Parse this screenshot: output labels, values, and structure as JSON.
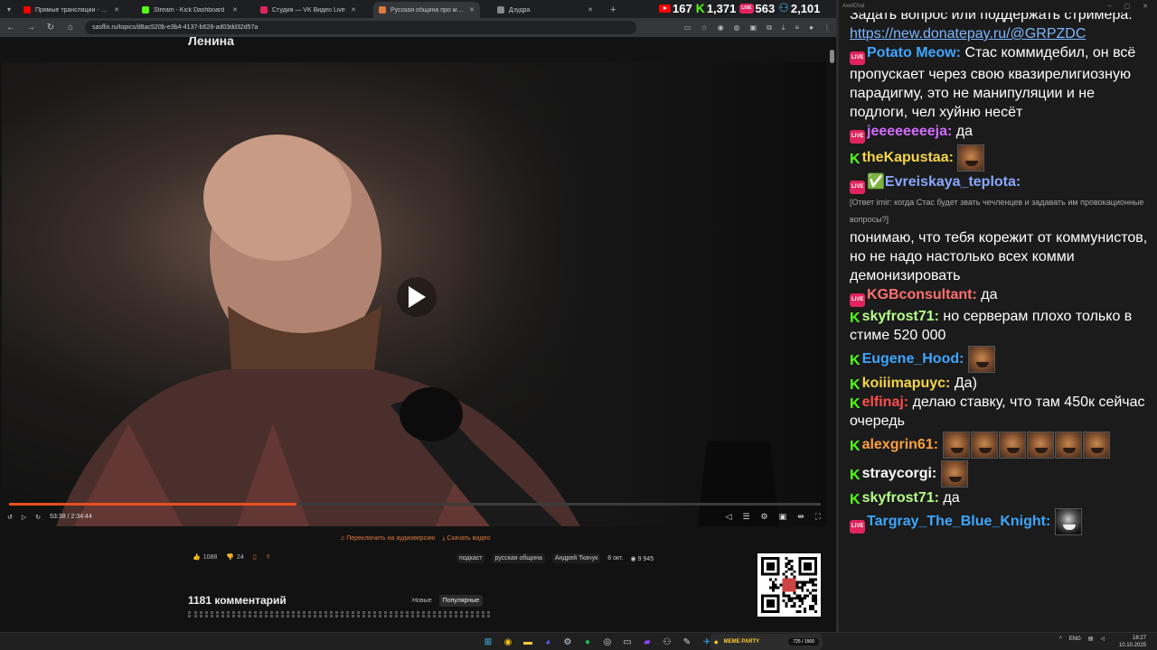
{
  "browser": {
    "tabs": [
      {
        "title": "Прямые трансляции - YouTube",
        "color": "#ff0000"
      },
      {
        "title": "Stream - Kick Dashboard",
        "color": "#53fc18"
      },
      {
        "title": "Студия — VK Видео Live",
        "color": "#e0245e"
      },
      {
        "title": "Русская община про мигрантов...",
        "color": "#e07a3c"
      },
      {
        "title": "Дзудра",
        "color": "#888888"
      }
    ],
    "url": "sasflix.ru/topics/d8ac520b-e3b4-4137-b628-ad03dd32d57a"
  },
  "counters": {
    "youtube": "167",
    "kick": "1,371",
    "vk": "563",
    "total": "2,101",
    "live_badge": "LIVE"
  },
  "page": {
    "heading": "Ленина",
    "video": {
      "time": "53:38 / 2:34:44",
      "progress": 0.354
    },
    "links": {
      "audio": "Переключить на аудиоверсию",
      "download": "Скачать видео"
    },
    "reactions": {
      "likes": "1088",
      "dislikes": "24"
    },
    "tags": [
      "подкаст",
      "русская община",
      "Андрей Ткачук"
    ],
    "date": "8 окт.",
    "views": "9 945",
    "comments_title": "1181 комментарий",
    "sort": {
      "new": "Новые",
      "popular": "Популярные"
    }
  },
  "chat": {
    "title": "AxelChat",
    "messages": [
      {
        "platform": "none",
        "nick": "",
        "nick_color": "#ffffff",
        "text": "Задать вопрос или поддержать стримера:"
      },
      {
        "platform": "none",
        "nick": "",
        "nick_color": "#ffffff",
        "text": "",
        "link": "https://new.donatepay.ru/@GRPZDC"
      },
      {
        "platform": "vk",
        "nick": "Potato Meow:",
        "nick_color": "#3ea6ff",
        "text": "Стас коммидебил, он всё пропускает через свою квазирелигиозную парадигму, это не манипуляции и не подлоги, чел хуйню несёт"
      },
      {
        "platform": "vk",
        "nick": "jeeeeeeeeja:",
        "nick_color": "#d36bff",
        "text": "да"
      },
      {
        "platform": "kick",
        "nick": "theKapustaa:",
        "nick_color": "#f5d547",
        "text": "",
        "emotes": 1
      },
      {
        "platform": "vk",
        "nick": "Evreiskaya_teplota:",
        "nick_color": "#8aa8ff",
        "badge": "✅",
        "text": ""
      },
      {
        "platform": "reply",
        "text": "[Ответ imir: когда Стас будет звать чечленцев и задавать им провокационные вопросы?]"
      },
      {
        "platform": "none",
        "nick": "",
        "nick_color": "#ffffff",
        "text": "понимаю, что тебя корежит от коммунистов, но не надо настолько всех комми демонизировать"
      },
      {
        "platform": "vk",
        "nick": "KGBconsultant:",
        "nick_color": "#ff6f6f",
        "text": "да"
      },
      {
        "platform": "kick",
        "nick": "skyfrost71:",
        "nick_color": "#b7ff8a",
        "text": "но серверам плохо только в стиме 520 000"
      },
      {
        "platform": "kick",
        "nick": "Eugene_Hood:",
        "nick_color": "#3ea6ff",
        "text": "",
        "emotes": 1
      },
      {
        "platform": "kick",
        "nick": "koiiimapuyc:",
        "nick_color": "#f5d547",
        "text": "Да)"
      },
      {
        "platform": "kick",
        "nick": "elfinaj:",
        "nick_color": "#ff4d4d",
        "text": "делаю ставку, что там 450к сейчас очередь"
      },
      {
        "platform": "kick",
        "nick": "alexgrin61:",
        "nick_color": "#ff9f40",
        "text": "",
        "emotes": 6
      },
      {
        "platform": "kick",
        "nick": "straycorgi:",
        "nick_color": "#ffffff",
        "text": "",
        "emotes": 1
      },
      {
        "platform": "kick",
        "nick": "skyfrost71:",
        "nick_color": "#b7ff8a",
        "text": "да"
      },
      {
        "platform": "vk",
        "nick": "Targray_The_Blue_Knight:",
        "nick_color": "#3ea6ff",
        "text": "",
        "emotes": 1,
        "emote_style": "dark"
      }
    ]
  },
  "taskbar": {
    "meme_title": "MEME PARTY",
    "meme_count": "725 / 1500",
    "lang": "ENG",
    "time": "18:27",
    "date": "10.10.2025"
  }
}
